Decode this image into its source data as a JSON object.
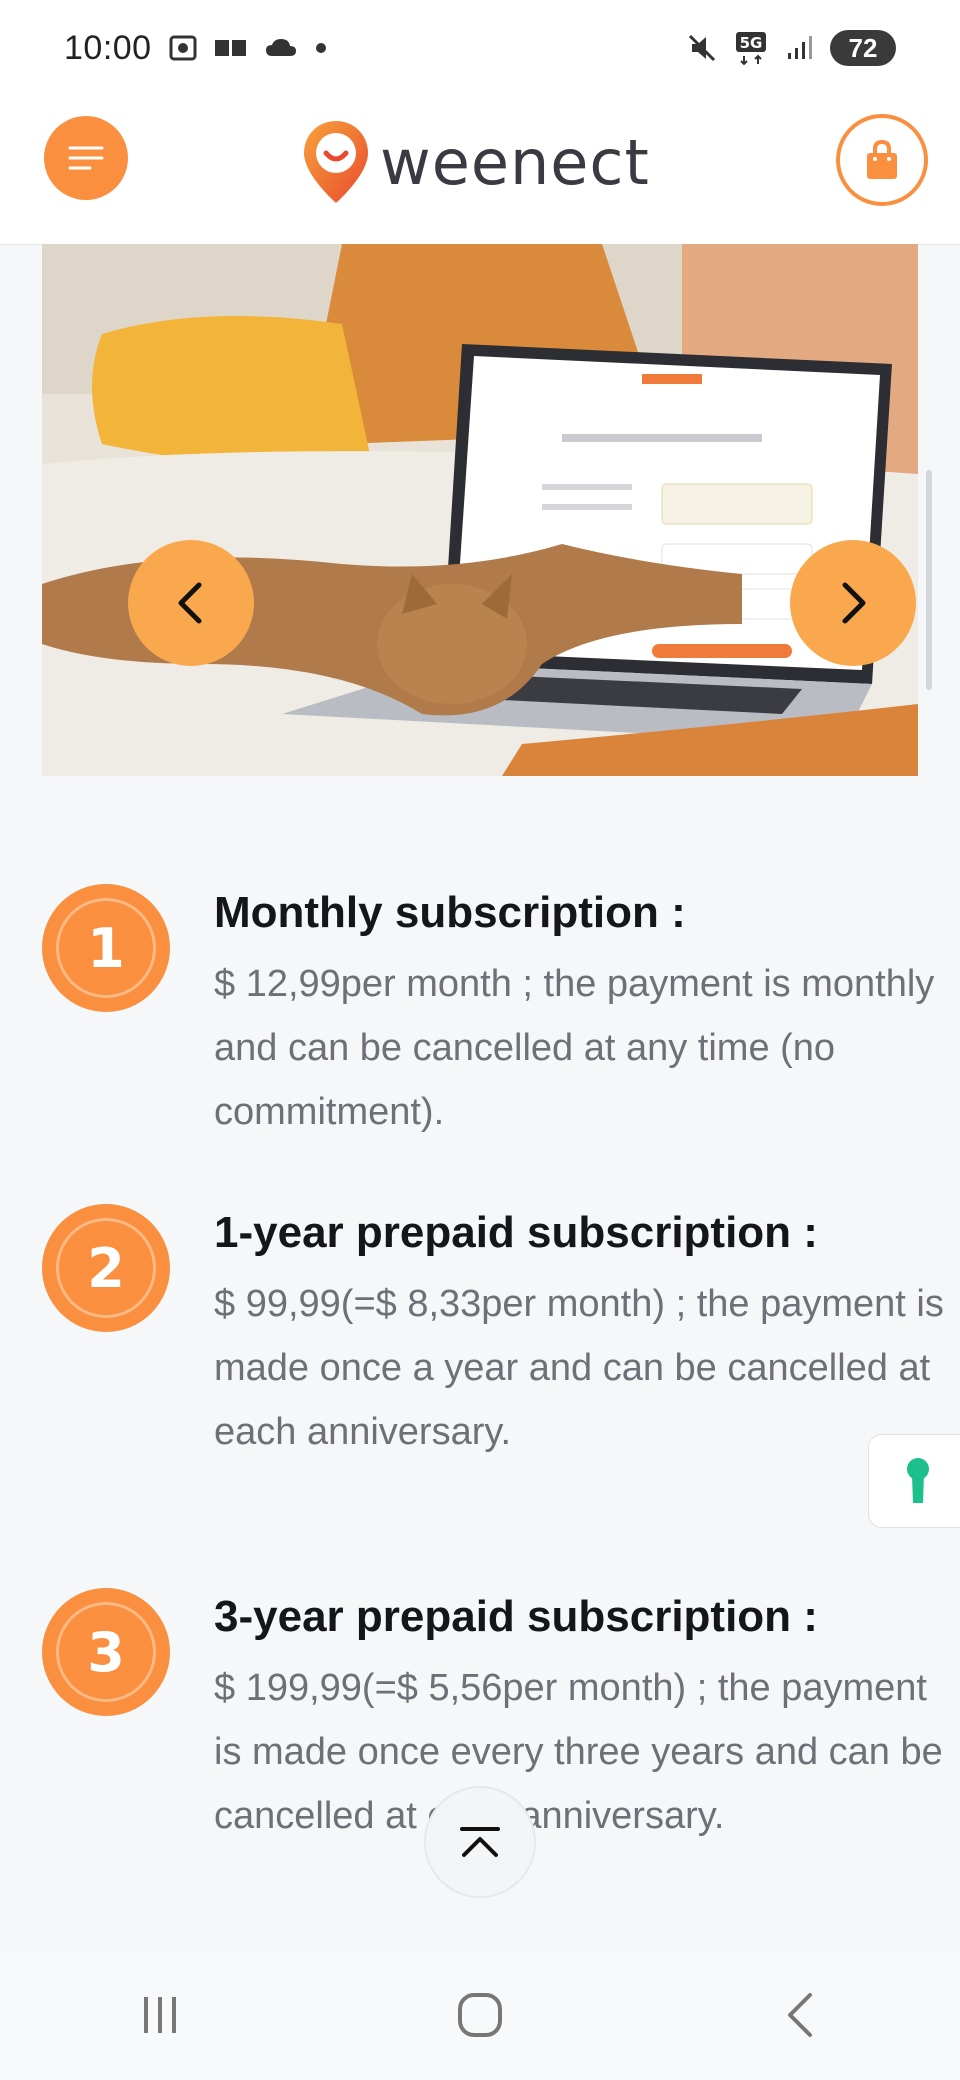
{
  "status_bar": {
    "time": "10:00",
    "battery": "72",
    "network": "5G",
    "icons": [
      "screenshot-icon",
      "sim-icon",
      "cloud-icon",
      "dot-icon",
      "mute-icon",
      "5g-icon",
      "signal-icon",
      "battery-icon"
    ]
  },
  "header": {
    "logo_text": "weenect",
    "menu_icon": "hamburger-icon",
    "cart_icon": "shopping-bag-icon",
    "brand_color": "#f98f3f"
  },
  "carousel": {
    "prev_icon": "chevron-left-icon",
    "next_icon": "chevron-right-icon"
  },
  "plans": [
    {
      "number": "1",
      "title": "Monthly subscription :",
      "description": "$ 12,99per month ; the payment is monthly and can be cancelled at any time (no commitment)."
    },
    {
      "number": "2",
      "title": "1-year prepaid subscription :",
      "description": "$ 99,99(=$ 8,33per month) ; the payment is made once a year and can be cancelled at each anniversary."
    },
    {
      "number": "3",
      "title": "3-year prepaid subscription :",
      "description": "$ 199,99(=$ 5,56per month) ; the payment is made once every three years and can be cancelled at each anniversary."
    }
  ],
  "floating": {
    "side_tab_icon": "keyhole-icon",
    "scroll_top_icon": "scroll-to-top-icon"
  },
  "nav": {
    "recent_icon": "recent-apps-icon",
    "home_icon": "home-icon",
    "back_icon": "back-icon"
  }
}
